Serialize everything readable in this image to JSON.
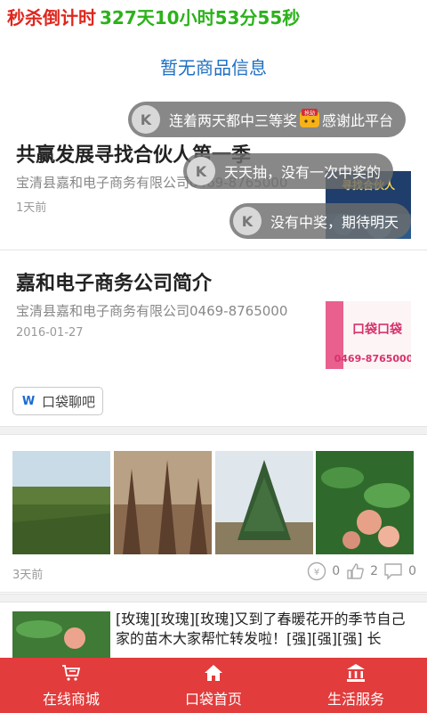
{
  "countdown": {
    "label": "秒杀倒计时",
    "time": "327天10小时53分55秒"
  },
  "shop": {
    "empty_text": "暂无商品信息"
  },
  "articles": [
    {
      "title": "共赢发展寻找合伙人第一季",
      "meta": "宝清县嘉和电子商务有限公司0469-8765000",
      "date": "1天前",
      "thumb_caption": "寻找合伙人"
    },
    {
      "title": "嘉和电子商务公司简介",
      "meta": "宝清县嘉和电子商务有限公司0469-8765000",
      "date": "2016-01-27",
      "thumb_caption": "口袋口袋",
      "thumb_phone": "0469-8765000"
    }
  ],
  "tag": {
    "label": "口袋聊吧"
  },
  "post": {
    "time": "3天前",
    "reward_count": "0",
    "like_count": "2",
    "comment_count": "0",
    "text": "[玫瑰][玫瑰][玫瑰]又到了春暖花开的季节自己家的苗木大家帮忙转发啦！[强][强][强] 长"
  },
  "danmaku": [
    {
      "text": "连着两天都中三等奖",
      "text_after": "感谢此平台",
      "emoji_caption": "抢劫"
    },
    {
      "text": "天天抽，没有一次中奖的"
    },
    {
      "text": "没有中奖，期待明天"
    }
  ],
  "tabs": [
    {
      "label": "在线商城",
      "icon": "cart-icon"
    },
    {
      "label": "口袋首页",
      "icon": "home-icon"
    },
    {
      "label": "生活服务",
      "icon": "bank-icon"
    }
  ],
  "colors": {
    "accent": "#e23c3c",
    "countdown_label": "#e0261d",
    "countdown_time": "#2bb21a",
    "empty_link": "#1e6fc2"
  }
}
